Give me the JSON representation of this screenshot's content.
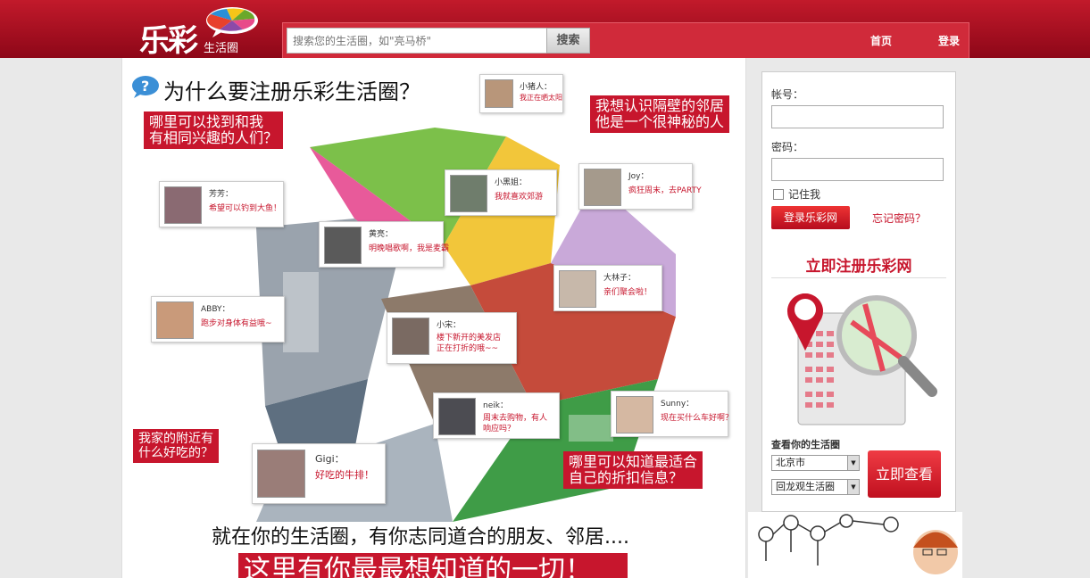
{
  "header": {
    "logo_text": "乐彩",
    "logo_sub": "生活圈",
    "search_placeholder": "搜索您的生活圈，如\"亮马桥\"",
    "search_button": "搜索",
    "nav_home": "首页",
    "nav_login": "登录"
  },
  "main": {
    "headline": "为什么要注册乐彩生活圈？",
    "red_labels": [
      "哪里可以找到和我\n有相同兴趣的人们？",
      "我想认识隔壁的邻居\n他是一个很神秘的人",
      "我家的附近有\n什么好吃的？",
      "哪里可以知道最适合\n自己的折扣信息？"
    ],
    "cards": [
      {
        "name": "小猪人：",
        "msg": "我正在晒太阳"
      },
      {
        "name": "芳芳：",
        "msg": "希望可以钓到大鱼！"
      },
      {
        "name": "小黑姐：",
        "msg": "我就喜欢郊游"
      },
      {
        "name": "Joy：",
        "msg": "疯狂周末，去PARTY"
      },
      {
        "name": "黄亮：",
        "msg": "明晚唱歌啊，我是麦霸"
      },
      {
        "name": "大林子：",
        "msg": "亲们聚会啦！"
      },
      {
        "name": "ABBY：",
        "msg": "跑步对身体有益哦~"
      },
      {
        "name": "小宋：",
        "msg": "楼下新开的美发店\n正在打折的哦~~"
      },
      {
        "name": "neik：",
        "msg": "周末去购物，有人\n响应吗？"
      },
      {
        "name": "Sunny：",
        "msg": "现在买什么车好啊？"
      },
      {
        "name": "Gigi：",
        "msg": "好吃的牛排！"
      }
    ],
    "bottom_line": "就在你的生活圈，有你志同道合的朋友、邻居....",
    "bottom_banner": "这里有你最最想知道的一切！"
  },
  "panel": {
    "account_label": "帐号：",
    "password_label": "密码：",
    "remember_label": "记住我",
    "login_button": "登录乐彩网",
    "forgot_link": "忘记密码？",
    "register_title": "立即注册乐彩网",
    "view_label": "查看你的生活圈",
    "city_select": "北京市",
    "circle_select": "回龙观生活圈",
    "view_button": "立即查看"
  },
  "colors": {
    "brand_red": "#c7162d",
    "header_dark": "#8d0718"
  }
}
